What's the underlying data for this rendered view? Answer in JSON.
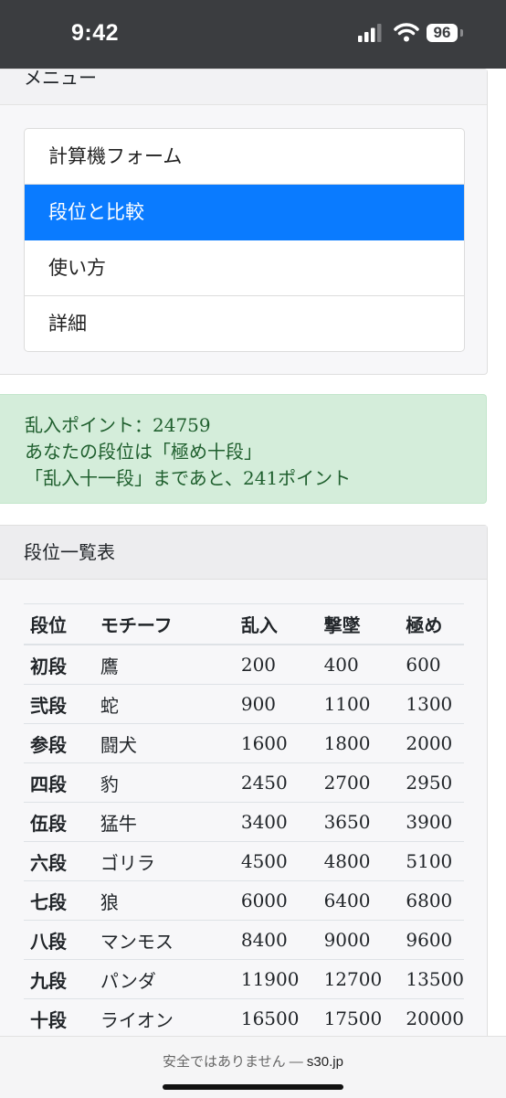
{
  "status_bar": {
    "time": "9:42",
    "battery": "96"
  },
  "menu": {
    "title": "メニュー",
    "items": [
      {
        "label": "計算機フォーム",
        "active": false
      },
      {
        "label": "段位と比較",
        "active": true
      },
      {
        "label": "使い方",
        "active": false
      },
      {
        "label": "詳細",
        "active": false
      }
    ]
  },
  "result": {
    "line1": "乱入ポイント：24759",
    "line2": "あなたの段位は「極め十段」",
    "line3": "「乱入十一段」まであと、241ポイント"
  },
  "rank_table": {
    "title": "段位一覧表",
    "headers": [
      "段位",
      "モチーフ",
      "乱入",
      "撃墜",
      "極め"
    ],
    "rows": [
      [
        "初段",
        "鷹",
        "200",
        "400",
        "600"
      ],
      [
        "弐段",
        "蛇",
        "900",
        "1100",
        "1300"
      ],
      [
        "参段",
        "闘犬",
        "1600",
        "1800",
        "2000"
      ],
      [
        "四段",
        "豹",
        "2450",
        "2700",
        "2950"
      ],
      [
        "伍段",
        "猛牛",
        "3400",
        "3650",
        "3900"
      ],
      [
        "六段",
        "ゴリラ",
        "4500",
        "4800",
        "5100"
      ],
      [
        "七段",
        "狼",
        "6000",
        "6400",
        "6800"
      ],
      [
        "八段",
        "マンモス",
        "8400",
        "9000",
        "9600"
      ],
      [
        "九段",
        "パンダ",
        "11900",
        "12700",
        "13500"
      ],
      [
        "十段",
        "ライオン",
        "16500",
        "17500",
        "20000"
      ]
    ]
  },
  "browser_bar": {
    "security_text": "安全ではありません — ",
    "domain": "s30.jp"
  },
  "colors": {
    "active_blue": "#0a7bff",
    "success_bg": "#d4edda",
    "success_text": "#1f5f2e"
  }
}
